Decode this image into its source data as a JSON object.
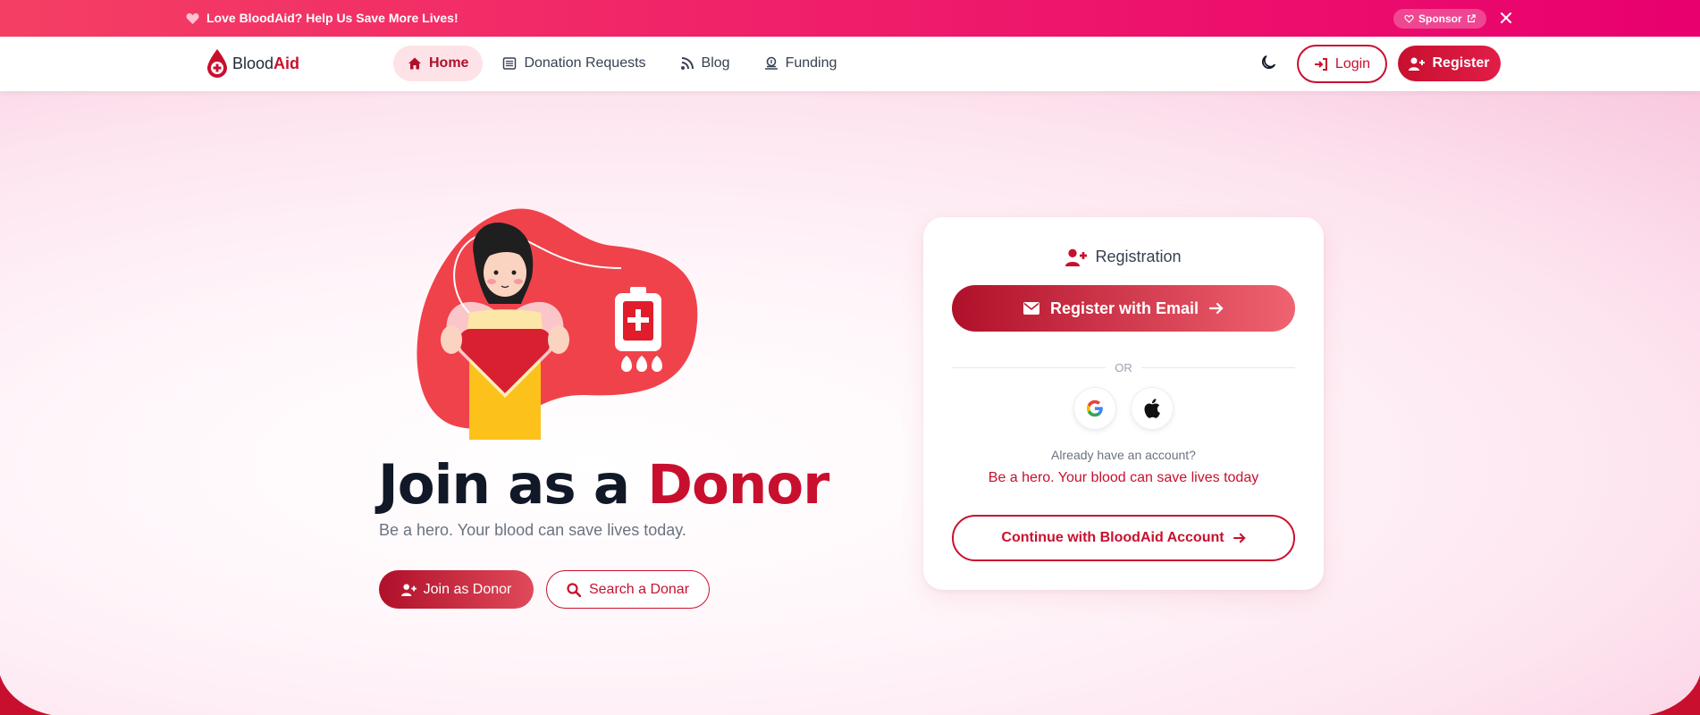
{
  "topbar": {
    "message": "Love BloodAid? Help Us Save More Lives!",
    "sponsor_label": "Sponsor",
    "close_icon": "close-icon"
  },
  "brand": {
    "name_plain": "Blood",
    "name_bold": "Aid",
    "accent": "#c8102e"
  },
  "nav": {
    "items": [
      {
        "label": "Home",
        "icon": "home-icon",
        "active": true
      },
      {
        "label": "Donation Requests",
        "icon": "list-icon",
        "active": false
      },
      {
        "label": "Blog",
        "icon": "rss-icon",
        "active": false
      },
      {
        "label": "Funding",
        "icon": "donate-icon",
        "active": false
      }
    ],
    "login_label": "Login",
    "register_label": "Register"
  },
  "hero": {
    "title_dark": "Join as a",
    "title_red": "Donor",
    "subtitle": "Be a hero. Your blood can save lives today.",
    "join_label": "Join as Donor",
    "search_label": "Search a Donar"
  },
  "registration": {
    "heading": "Registration",
    "email_button": "Register with Email",
    "or_text": "OR",
    "have_account": "Already have an account?",
    "hero_line": "Be a hero. Your blood can save lives today",
    "continue_button": "Continue with BloodAid Account"
  }
}
